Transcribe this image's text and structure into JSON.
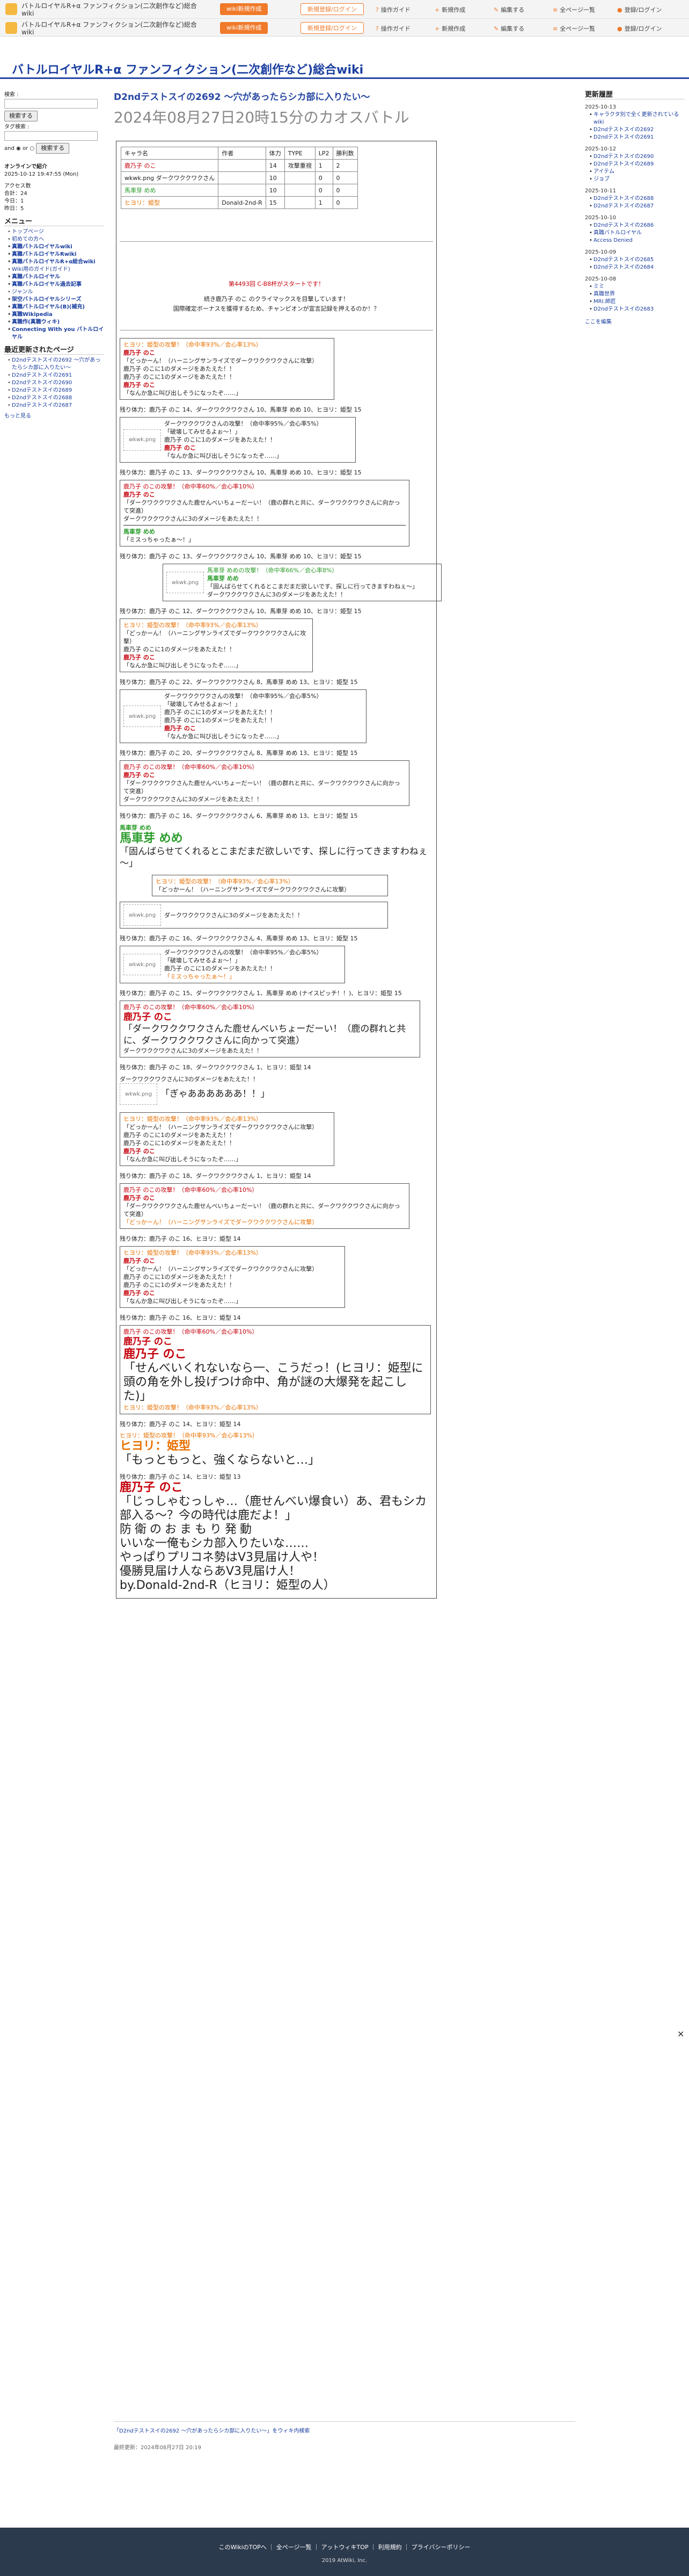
{
  "topbar": {
    "site_name": "バトルロイヤルR+α ファンフィクション(二次創作など)総合wiki",
    "new_wiki": "wiki新規作成",
    "login": "新規登録/ログイン",
    "nav": [
      "操作ガイド",
      "新規作成",
      "編集する",
      "全ページ一覧",
      "登録/ログイン"
    ]
  },
  "header": {
    "title": "バトルロイヤルR+α ファンフィクション(二次創作など)総合wiki"
  },
  "left": {
    "search_label": "検索 :",
    "search_button": "検索する",
    "tag_label": "タグ検索 :",
    "tag_button": "検索する",
    "and": "and",
    "or": "or",
    "search2_button": "検索する",
    "online_title": "オンラインで紹介",
    "online_date": "2025-10-12 19:47:55 (Mon)",
    "access_title": "アクセス数",
    "access": [
      "合計：24",
      "今日：1",
      "昨日：5"
    ],
    "menu_title": "メニュー",
    "menu": [
      "トップページ",
      "初めての方へ",
      "真職バトルロイヤルwiki",
      "真職バトルロイヤルRwiki",
      "真職バトルロイヤルR+α総合wiki",
      "Wiki用のガイド(ガイド)",
      "真職バトルロイヤル",
      "真職バトルロイヤル過去記事",
      "ジャンル",
      "架空バトルロイヤルシリーズ",
      "真職バトルロイヤル(B)(補充)",
      "真職Wikipedia",
      "真職作(真職ウィキ)",
      "Connecting With you バトルロイヤル"
    ],
    "recent_title": "最近更新されたページ",
    "recent": [
      "D2ndテストスイの2692 〜穴があったらシカ部に入りたい〜",
      "D2ndテストスイの2691",
      "D2ndテストスイの2690",
      "D2ndテストスイの2689",
      "D2ndテストスイの2688",
      "D2ndテストスイの2687"
    ],
    "more": "もっと見る"
  },
  "right": {
    "title": "更新履歴",
    "groups": [
      {
        "date": "2025-10-13",
        "items": [
          "キャラクタ別で全く更新されているwiki",
          "D2ndテストスイの2692",
          "D2ndテストスイの2691"
        ]
      },
      {
        "date": "2025-10-12",
        "items": [
          "D2ndテストスイの2690",
          "D2ndテストスイの2689",
          "アイテム",
          "ジョブ"
        ]
      },
      {
        "date": "2025-10-11",
        "items": [
          "D2ndテストスイの2688",
          "D2ndテストスイの2687"
        ]
      },
      {
        "date": "2025-10-10",
        "items": [
          "D2ndテストスイの2686",
          "真職バトルロイヤル",
          "Access Denied"
        ]
      },
      {
        "date": "2025-10-09",
        "items": [
          "D2ndテストスイの2685",
          "D2ndテストスイの2684"
        ]
      },
      {
        "date": "2025-10-08",
        "items": [
          "ミミ",
          "真職世界",
          "MRI.師匠",
          "D2ndテストスイの2683"
        ]
      }
    ],
    "more": "ここを編集"
  },
  "page": {
    "h1": "D2ndテストスイの2692 〜穴があったらシカ部に入りたい〜",
    "h2": "2024年08月27日20時15分のカオスバトル"
  },
  "chars": {
    "headers": [
      "キャラ名",
      "作者",
      "体力",
      "TYPE",
      "LP2",
      "勝利数"
    ],
    "rows": [
      [
        "鹿乃子 のこ",
        "",
        "14",
        "攻撃重視",
        "1",
        "2"
      ],
      [
        "wkwk.png ダークワククワクさん",
        "",
        "10",
        "",
        "0",
        "0"
      ],
      [
        "馬車芽 めめ",
        "",
        "10",
        "",
        "0",
        "0"
      ],
      [
        "ヒヨリ：姫型",
        "Donald-2nd-R",
        "15",
        "",
        "1",
        "0"
      ]
    ]
  },
  "intro": {
    "l1": "第4493回 C-B8杯がスタートです！",
    "l2": "続き鹿乃子 のこ のクライマックスを目撃しています！",
    "l3": "国際確定ボーナスを獲得するため、チャンピオンが宣言記録を押えるのか！？"
  },
  "turns": [
    {
      "label": "残り体力：鹿乃子 のこ 14、ダークワククワクさん 10、馬車芽 めめ 10、ヒヨリ：姫型 15"
    },
    {
      "label": "残り体力：鹿乃子 のこ 13、ダークワククワクさん 10、馬車芽 めめ 10、ヒヨリ：姫型 15"
    },
    {
      "label": "残り体力：鹿乃子 のこ 13、ダークワククワクさん 10、馬車芽 めめ 10、ヒヨリ：姫型 15"
    },
    {
      "label": "残り体力：鹿乃子 のこ 12、ダークワククワクさん 10、馬車芽 めめ 10、ヒヨリ：姫型 15"
    },
    {
      "label": "残り体力：鹿乃子 のこ 22、ダークワククワクさん 8、馬車芽 めめ 13、ヒヨリ：姫型 15"
    },
    {
      "label": "残り体力：鹿乃子 のこ 20、ダークワククワクさん 8、馬車芽 めめ 13、ヒヨリ：姫型 15"
    },
    {
      "label": "残り体力：鹿乃子 のこ 16、ダークワククワクさん 6、馬車芽 めめ 13、ヒヨリ：姫型 15"
    },
    {
      "label": "残り体力：鹿乃子 のこ 16、ダークワククワクさん 4、馬車芽 めめ 13、ヒヨリ：姫型 15"
    },
    {
      "label": "残り体力：鹿乃子 のこ 15、ダークワククワクさん 1、馬車芽 めめ (ナイスピッチ！！)、ヒヨリ：姫型 15"
    },
    {
      "label": "残り体力：鹿乃子 のこ 18、ダークワククワクさん 1、ヒヨリ：姫型 14"
    },
    {
      "label": "残り体力：鹿乃子 のこ 18、ダークワククワクさん 1、ヒヨリ：姫型 14"
    },
    {
      "label": "残り体力：鹿乃子 のこ 16、ヒヨリ：姫型 14"
    },
    {
      "label": "残り体力：鹿乃子 のこ 16、ヒヨリ：姫型 14"
    },
    {
      "label": "残り体力：鹿乃子 のこ 14、ヒヨリ：姫型 14"
    },
    {
      "label": "残り体力：鹿乃子 のこ 14、ヒヨリ：姫型 13"
    }
  ],
  "lines": {
    "hiyori_attack": "ヒヨリ：姫型の攻撃！（命中率93%／会心率13%）",
    "noko_attack": "鹿乃子 のこの攻撃！（命中率60%／会心率10%）",
    "dark_attack": "ダークワククワクさんの攻撃！（命中率95%／会心率5%）",
    "meme_attack": "馬車芽 めめの攻撃！（命中率66%／会心率8%）",
    "noko_name": "鹿乃子 のこ",
    "noko_quote": "「なんか急に叫び出しそうになったぞ……」",
    "noko_dmg": "鹿乃子 のこに1のダメージをあたえた！！",
    "dark_dmg": "ダークワククワクさんに3のダメージをあたえた！！",
    "hiyori_quote": "「どっかーん！（ハーニングサンライズでダークワククワクさんに攻撃）",
    "dark_quote": "「破壊してみせるよぉ～！」",
    "meme_quote": "「ミスっちゃったぁ～！」",
    "wkwk": "wkwk.png",
    "meme_big": "馬車芽 めめ",
    "meme_big_quote": "「固んばらせてくれるとこまだまだ欲しいです、探しに行ってきますわねぇ～」",
    "noko_big": "鹿乃子 のこ",
    "noko_big_quote": "「ダークワククワクさんた鹿せんべいちょーだーい！（鹿の群れと共に、ダークワククワクさんに向かって突進）",
    "dark_scream": "「ぎゃああああああ！！」",
    "final1": "「せんべいくれないなら一、こうだっ！(ヒヨリ：姫型に頭の角を外し投げつけ命中、角が謎の大爆発を起こした)」",
    "final_win": "ヒヨリ：姫型",
    "final2": "「もっともっと、強くならないと…」",
    "final3": "「じっしゃむっしゃ…（鹿せんべい爆食い）あ、君もシカ部入る～？今の時代は鹿だよ！」",
    "final4": "防衛のおまもり発動",
    "final5": "いいな一俺もシカ部入りたいな……",
    "final6": "やっぱりプリコネ勢はV3見届け人や！",
    "final7": "優勝見届け人ならあV3見届け人！",
    "final8": "by.Donald-2nd-R（ヒヨリ：姫型の人）"
  },
  "footer_bar": {
    "link": "「D2ndテストスイの2692 〜穴があったらシカ部に入りたい〜」をウィキ内検索",
    "updated": "最終更新：2024年08月27日 20:19"
  },
  "footer": {
    "links": [
      "このWikiのTOPへ",
      "全ページ一覧",
      "アットウィキTOP",
      "利用規約",
      "プライバシーポリシー"
    ],
    "copy": "2019 AtWiki, Inc."
  },
  "colors": {
    "accent": "#2747a3",
    "orange": "#f07a2a",
    "red": "#c4000a",
    "green": "#2c9c2c"
  }
}
